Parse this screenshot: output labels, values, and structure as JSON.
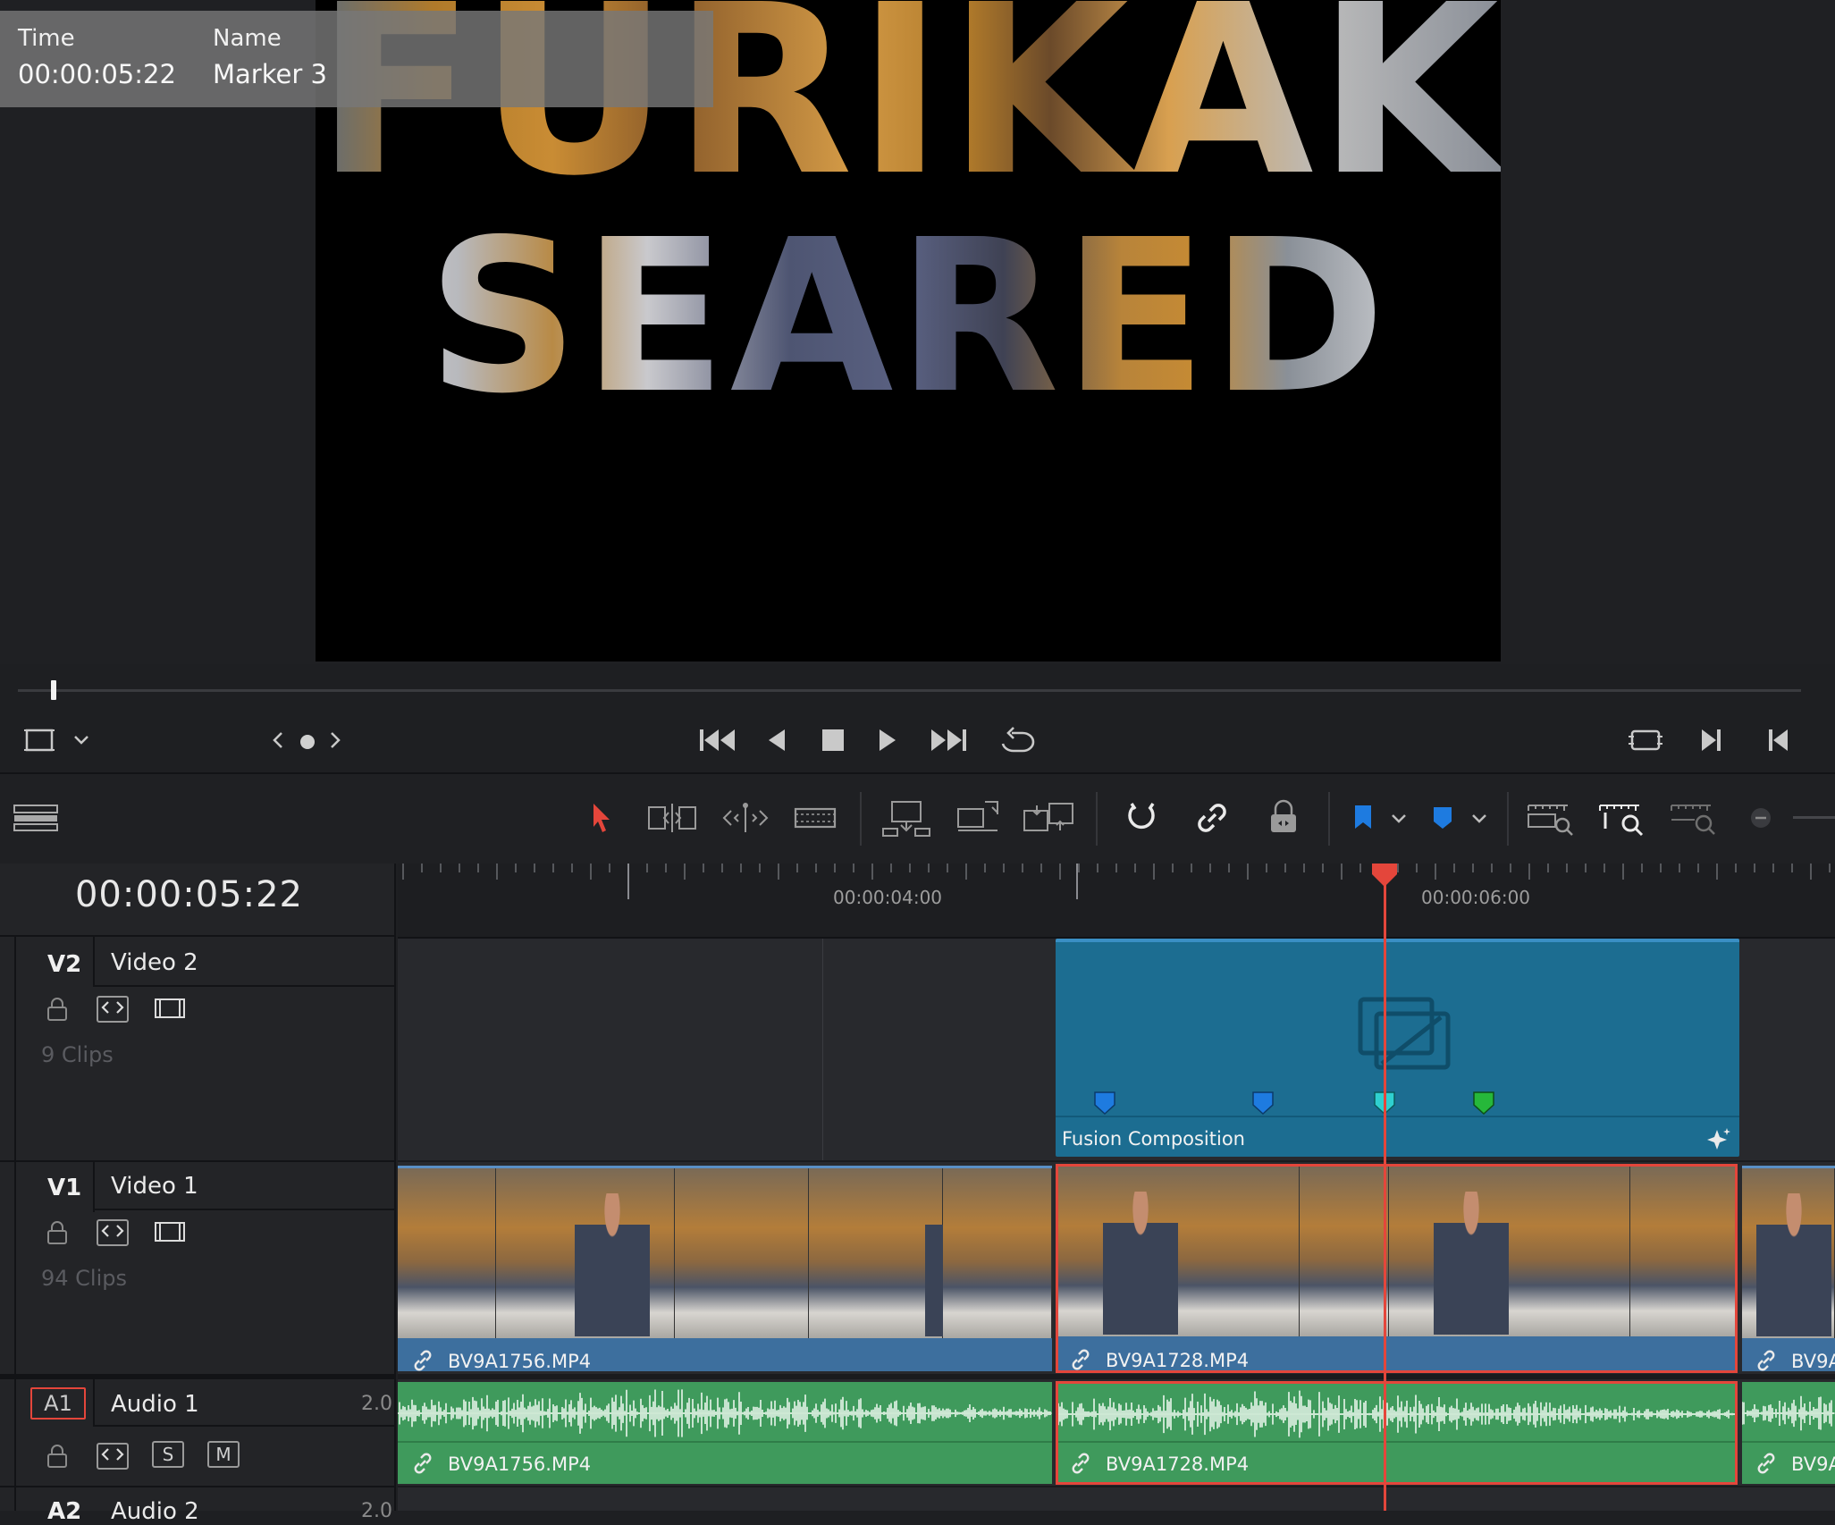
{
  "viewer": {
    "title_line1": "FURIKAKE",
    "title_line2": "SEARED",
    "marker_tooltip": {
      "time_label": "Time",
      "time_value": "00:00:05:22",
      "name_label": "Name",
      "name_value": "Marker 3"
    },
    "scrubber_progress": 0.02
  },
  "timeline": {
    "timecode": "00:00:05:22",
    "ruler_labels": [
      "00:00:04:00",
      "00:00:06:00"
    ],
    "tracks": [
      {
        "id": "V2",
        "name": "Video 2",
        "clips": "9 Clips"
      },
      {
        "id": "V1",
        "name": "Video 1",
        "clips": "94 Clips"
      },
      {
        "id": "A1",
        "name": "Audio 1",
        "channels": "2.0",
        "solo": "S",
        "mute": "M"
      },
      {
        "id": "A2",
        "name": "Audio 2",
        "channels": "2.0"
      }
    ],
    "clips": {
      "fusion": "Fusion Composition",
      "v1_a": "BV9A1756.MP4",
      "v1_b": "BV9A1728.MP4",
      "v1_c": "BV9A",
      "a1_a": "BV9A1756.MP4",
      "a1_b": "BV9A1728.MP4",
      "a1_c": "BV9A"
    }
  },
  "colors": {
    "accent_red": "#e4463b",
    "fusion_clip": "#1c6d91",
    "video_clip": "#3d6f9e",
    "audio_clip": "#3f9a5c",
    "marker_blue": "#1e7be0",
    "marker_cyan": "#2fd0d0",
    "marker_green": "#26b83a"
  }
}
